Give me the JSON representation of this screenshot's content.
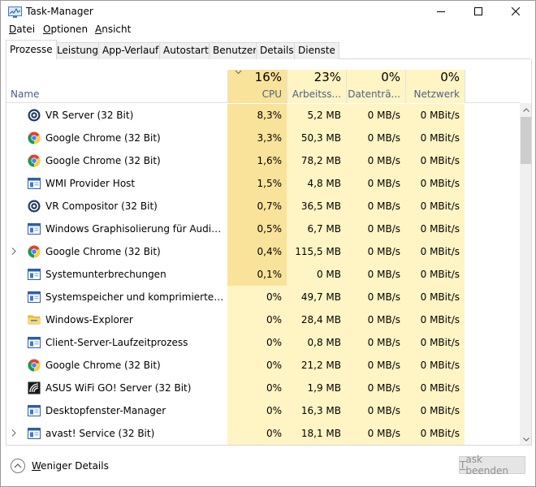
{
  "window": {
    "title": "Task-Manager"
  },
  "menu": {
    "items": [
      {
        "label_ul": "D",
        "label_rest": "atei"
      },
      {
        "label_ul": "O",
        "label_rest": "ptionen"
      },
      {
        "label_ul": "A",
        "label_rest": "nsicht"
      }
    ]
  },
  "tabs": [
    "Prozesse",
    "Leistung",
    "App-Verlauf",
    "Autostart",
    "Benutzer",
    "Details",
    "Dienste"
  ],
  "active_tab": "Prozesse",
  "columns": {
    "name": "Name",
    "cpu": {
      "pct": "16%",
      "label": "CPU"
    },
    "mem": {
      "pct": "23%",
      "label": "Arbeitss..."
    },
    "disk": {
      "pct": "0%",
      "label": "Datenträ..."
    },
    "net": {
      "pct": "0%",
      "label": "Netzwerk"
    }
  },
  "heat_colors": {
    "light": "#fff4c4",
    "medium": "#ffec9f",
    "strong": "#f9e39a"
  },
  "rows": [
    {
      "name": "VR Server (32 Bit)",
      "icon": "vr-icon",
      "expandable": false,
      "cpu": "8,3%",
      "mem": "5,2 MB",
      "disk": "0 MB/s",
      "net": "0 MBit/s",
      "cpu_heat": "strong"
    },
    {
      "name": "Google Chrome (32 Bit)",
      "icon": "chrome-icon",
      "expandable": false,
      "cpu": "3,3%",
      "mem": "50,3 MB",
      "disk": "0 MB/s",
      "net": "0 MBit/s",
      "cpu_heat": "strong"
    },
    {
      "name": "Google Chrome (32 Bit)",
      "icon": "chrome-icon",
      "expandable": false,
      "cpu": "1,6%",
      "mem": "78,2 MB",
      "disk": "0 MB/s",
      "net": "0 MBit/s",
      "cpu_heat": "strong"
    },
    {
      "name": "WMI Provider Host",
      "icon": "service-icon",
      "expandable": false,
      "cpu": "1,5%",
      "mem": "4,8 MB",
      "disk": "0 MB/s",
      "net": "0 MBit/s",
      "cpu_heat": "strong"
    },
    {
      "name": "VR Compositor (32 Bit)",
      "icon": "vr-icon",
      "expandable": false,
      "cpu": "0,7%",
      "mem": "36,5 MB",
      "disk": "0 MB/s",
      "net": "0 MBit/s",
      "cpu_heat": "strong"
    },
    {
      "name": "Windows Graphisolierung für Audioger...",
      "icon": "window-app-icon",
      "expandable": false,
      "cpu": "0,5%",
      "mem": "6,7 MB",
      "disk": "0 MB/s",
      "net": "0 MBit/s",
      "cpu_heat": "strong"
    },
    {
      "name": "Google Chrome (32 Bit)",
      "icon": "chrome-icon",
      "expandable": true,
      "cpu": "0,4%",
      "mem": "115,5 MB",
      "disk": "0 MB/s",
      "net": "0 MBit/s",
      "cpu_heat": "strong"
    },
    {
      "name": "Systemunterbrechungen",
      "icon": "window-app-icon",
      "expandable": false,
      "cpu": "0,1%",
      "mem": "0 MB",
      "disk": "0 MB/s",
      "net": "0 MBit/s",
      "cpu_heat": "strong"
    },
    {
      "name": "Systemspeicher und komprimierter Spe...",
      "icon": "window-app-icon",
      "expandable": false,
      "cpu": "0%",
      "mem": "49,7 MB",
      "disk": "0 MB/s",
      "net": "0 MBit/s",
      "cpu_heat": "light"
    },
    {
      "name": "Windows-Explorer",
      "icon": "folder-icon",
      "expandable": false,
      "cpu": "0%",
      "mem": "28,4 MB",
      "disk": "0 MB/s",
      "net": "0 MBit/s",
      "cpu_heat": "light"
    },
    {
      "name": "Client-Server-Laufzeitprozess",
      "icon": "window-app-icon",
      "expandable": false,
      "cpu": "0%",
      "mem": "0,8 MB",
      "disk": "0 MB/s",
      "net": "0 MBit/s",
      "cpu_heat": "light"
    },
    {
      "name": "Google Chrome (32 Bit)",
      "icon": "chrome-icon",
      "expandable": false,
      "cpu": "0%",
      "mem": "21,2 MB",
      "disk": "0 MB/s",
      "net": "0 MBit/s",
      "cpu_heat": "light"
    },
    {
      "name": "ASUS WiFi GO! Server (32 Bit)",
      "icon": "asus-wifi-icon",
      "expandable": false,
      "cpu": "0%",
      "mem": "1,9 MB",
      "disk": "0 MB/s",
      "net": "0 MBit/s",
      "cpu_heat": "light"
    },
    {
      "name": "Desktopfenster-Manager",
      "icon": "window-app-icon",
      "expandable": false,
      "cpu": "0%",
      "mem": "16,3 MB",
      "disk": "0 MB/s",
      "net": "0 MBit/s",
      "cpu_heat": "light"
    },
    {
      "name": "avast! Service (32 Bit)",
      "icon": "window-app-icon",
      "expandable": true,
      "cpu": "0%",
      "mem": "18,1 MB",
      "disk": "0 MB/s",
      "net": "0 MBit/s",
      "cpu_heat": "light"
    }
  ],
  "footer": {
    "less_ul": "W",
    "less_rest": "eniger Details",
    "end_ul": "T",
    "end_rest": "ask beenden"
  }
}
